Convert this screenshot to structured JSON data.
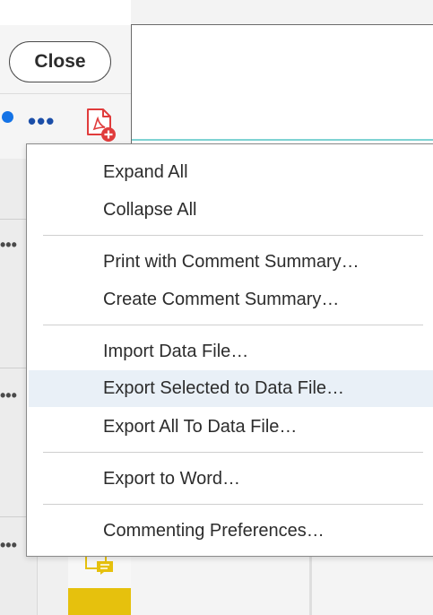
{
  "header": {
    "close_label": "Close"
  },
  "toolbar": {
    "more_label": "•••"
  },
  "left_cards": {
    "more_label": "•••"
  },
  "menu": {
    "items": [
      {
        "label": "Expand All"
      },
      {
        "label": "Collapse All"
      },
      {
        "label": "Print with Comment Summary…"
      },
      {
        "label": "Create Comment Summary…"
      },
      {
        "label": "Import Data File…"
      },
      {
        "label": "Export Selected to Data File…",
        "highlighted": true
      },
      {
        "label": "Export All To Data File…"
      },
      {
        "label": "Export to Word…"
      },
      {
        "label": "Commenting Preferences…"
      }
    ]
  },
  "colors": {
    "accent_blue": "#1473e6",
    "pdf_red": "#e03c3c",
    "highlight_bg": "#e9f0f7",
    "comment_yellow": "#e6c10d",
    "teal_rule": "#7fd3d3"
  },
  "icons": [
    "more-icon",
    "pdf-add-icon",
    "comment-icon"
  ]
}
